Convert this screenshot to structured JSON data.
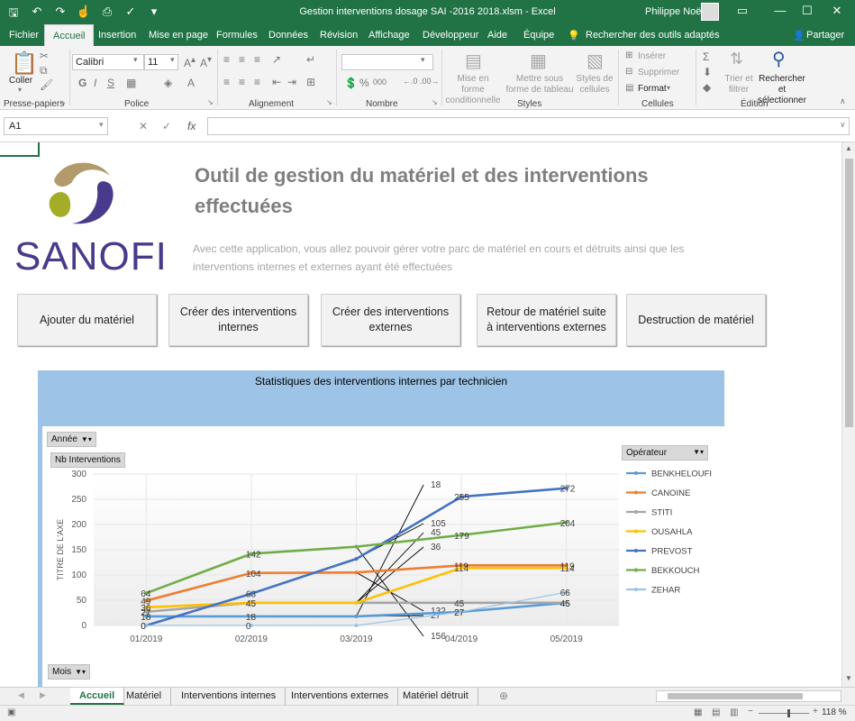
{
  "window": {
    "title": "Gestion interventions dosage SAI -2016 2018.xlsm  -  Excel",
    "user": "Philippe Noël"
  },
  "ribbon_tabs": [
    "Fichier",
    "Accueil",
    "Insertion",
    "Mise en page",
    "Formules",
    "Données",
    "Révision",
    "Affichage",
    "Développeur",
    "Aide",
    "Équipe"
  ],
  "ribbon_search": "Rechercher des outils adaptés",
  "share_label": "Partager",
  "ribbon": {
    "paste_label": "Coller",
    "font_name": "Calibri",
    "font_size": "11",
    "percent_symbol": "%",
    "number_group": "000",
    "conditional_label": "Mise en forme conditionnelle",
    "table_label": "Mettre sous forme de tableau",
    "styles_label": "Styles de cellules",
    "insert_label": "Insérer",
    "delete_label": "Supprimer",
    "format_label": "Format",
    "sort_label": "Trier et filtrer",
    "find_label": "Rechercher et sélectionner",
    "groups": [
      "Presse-papiers",
      "Police",
      "Alignement",
      "Nombre",
      "Styles",
      "Cellules",
      "Édition"
    ]
  },
  "formula_bar": {
    "name_box": "A1",
    "fx_label": "fx",
    "value": ""
  },
  "sheet": {
    "logo_text": "SANOFI",
    "header": "Outil de gestion du matériel et des interventions effectuées",
    "description": "Avec cette application, vous allez pouvoir gérer votre parc de matériel en cours et détruits ainsi que les interventions internes et externes ayant été effectuées",
    "buttons": [
      "Ajouter du matériel",
      "Créer des interventions internes",
      "Créer des interventions externes",
      "Retour de matériel suite à interventions externes",
      "Destruction de matériel"
    ]
  },
  "chart_filters": {
    "year": "Année",
    "measure": "Nb Interventions",
    "operator": "Opérateur",
    "month": "Mois"
  },
  "chart_data": {
    "type": "line",
    "title": "Statistiques des interventions internes par technicien",
    "ylabel": "TITRE DE L'AXE",
    "categories": [
      "01/2019",
      "02/2019",
      "03/2019",
      "04/2019",
      "05/2019"
    ],
    "ylim": [
      0,
      300
    ],
    "yticks": [
      0,
      50,
      100,
      150,
      200,
      250,
      300
    ],
    "series": [
      {
        "name": "BENKHELOUFI",
        "color": "#5b9bd5",
        "values": [
          18,
          18,
          18,
          27,
          45
        ]
      },
      {
        "name": "CANOINE",
        "color": "#ed7d31",
        "values": [
          49,
          104,
          105,
          119,
          119
        ]
      },
      {
        "name": "STITI",
        "color": "#a5a5a5",
        "values": [
          27,
          45,
          45,
          45,
          45
        ]
      },
      {
        "name": "OUSAHLA",
        "color": "#ffc000",
        "values": [
          36,
          45,
          45,
          114,
          114
        ]
      },
      {
        "name": "PREVOST",
        "color": "#4472c4",
        "values": [
          0,
          63,
          132,
          255,
          272
        ]
      },
      {
        "name": "BEKKOUCH",
        "color": "#70ad47",
        "values": [
          64,
          142,
          156,
          179,
          204
        ]
      },
      {
        "name": "ZEHAR",
        "color": "#9dc3e6",
        "values": [
          0,
          0,
          0,
          27,
          66
        ]
      }
    ],
    "callouts": [
      "18",
      "105",
      "45",
      "36",
      "132",
      "27",
      "156"
    ]
  },
  "sheet_tabs": [
    "Accueil",
    "Matériel",
    "Interventions internes",
    "Interventions externes",
    "Matériel détruit"
  ],
  "status": {
    "zoom": "118 %"
  }
}
